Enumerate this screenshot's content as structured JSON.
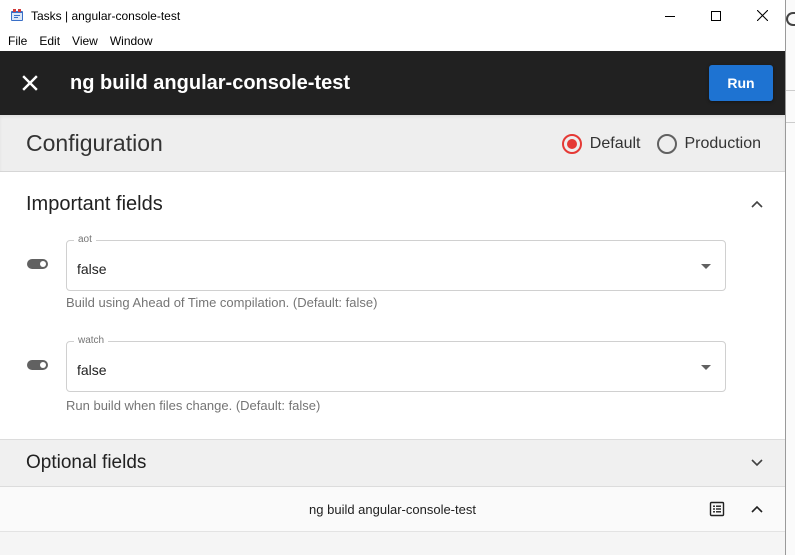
{
  "window": {
    "title": "Tasks | angular-console-test"
  },
  "menu": {
    "items": [
      "File",
      "Edit",
      "View",
      "Window"
    ]
  },
  "header": {
    "title": "ng build angular-console-test",
    "run_label": "Run"
  },
  "configuration": {
    "title": "Configuration",
    "options": [
      {
        "label": "Default",
        "selected": true
      },
      {
        "label": "Production",
        "selected": false
      }
    ]
  },
  "important_fields": {
    "title": "Important fields",
    "fields": [
      {
        "legend": "aot",
        "value": "false",
        "hint": "Build using Ahead of Time compilation. (Default: false)"
      },
      {
        "legend": "watch",
        "value": "false",
        "hint": "Run build when files change. (Default: false)"
      }
    ]
  },
  "optional_fields": {
    "title": "Optional fields"
  },
  "footer": {
    "command": "ng build angular-console-test"
  },
  "colors": {
    "header_bg": "#212121",
    "run_button": "#1e73d2",
    "radio_selected": "#e53935"
  }
}
